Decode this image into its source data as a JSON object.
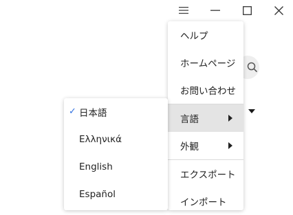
{
  "titlebar": {
    "icons": [
      "hamburger-menu-icon",
      "minimize-icon",
      "maximize-icon",
      "close-icon"
    ]
  },
  "background": {
    "icons": [
      "search-icon",
      "caret-down-icon"
    ]
  },
  "main_menu": {
    "items": [
      {
        "label": "ヘルプ"
      },
      {
        "label": "ホームページ"
      },
      {
        "label": "お問い合わせ"
      },
      {
        "label": "言語",
        "has_submenu": true,
        "active": true
      },
      {
        "label": "外観",
        "has_submenu": true
      },
      {
        "label": "エクスポート"
      },
      {
        "label": "インポート"
      }
    ]
  },
  "language_menu": {
    "selected": "日本語",
    "items": [
      {
        "label": "日本語",
        "checked": true
      },
      {
        "label": "Ελληνικά"
      },
      {
        "label": "English"
      },
      {
        "label": "Español"
      }
    ]
  },
  "colors": {
    "check": "#2f6fe0",
    "active_item": "#e4e4e4"
  }
}
